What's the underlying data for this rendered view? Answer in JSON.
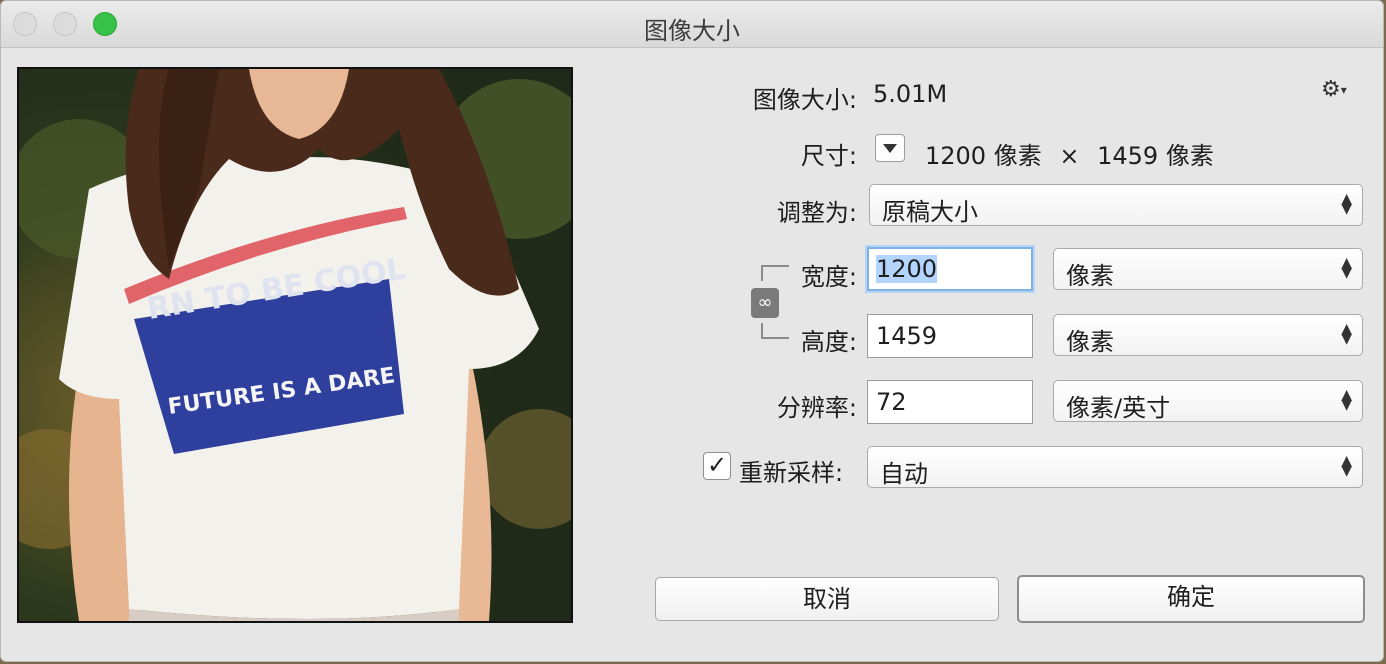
{
  "window": {
    "title": "图像大小"
  },
  "image_size": {
    "label": "图像大小:",
    "value": "5.01M"
  },
  "dimensions": {
    "label": "尺寸:",
    "width": "1200",
    "width_unit": "像素",
    "times": "×",
    "height": "1459",
    "height_unit": "像素"
  },
  "fit_to": {
    "label": "调整为:",
    "value": "原稿大小"
  },
  "width_field": {
    "label": "宽度:",
    "value": "1200",
    "unit": "像素"
  },
  "height_field": {
    "label": "高度:",
    "value": "1459",
    "unit": "像素"
  },
  "resolution": {
    "label": "分辨率:",
    "value": "72",
    "unit": "像素/英寸"
  },
  "resample": {
    "label": "重新采样:",
    "checked": true,
    "value": "自动"
  },
  "buttons": {
    "cancel": "取消",
    "ok": "确定"
  },
  "preview_image": {
    "shirt_text_top": "RN TO BE COOL",
    "shirt_text_bottom": "FUTURE IS A DARE"
  },
  "icons": {
    "settings": "gear-icon",
    "link": "chain-link-icon",
    "checkmark": "checkmark-icon"
  }
}
